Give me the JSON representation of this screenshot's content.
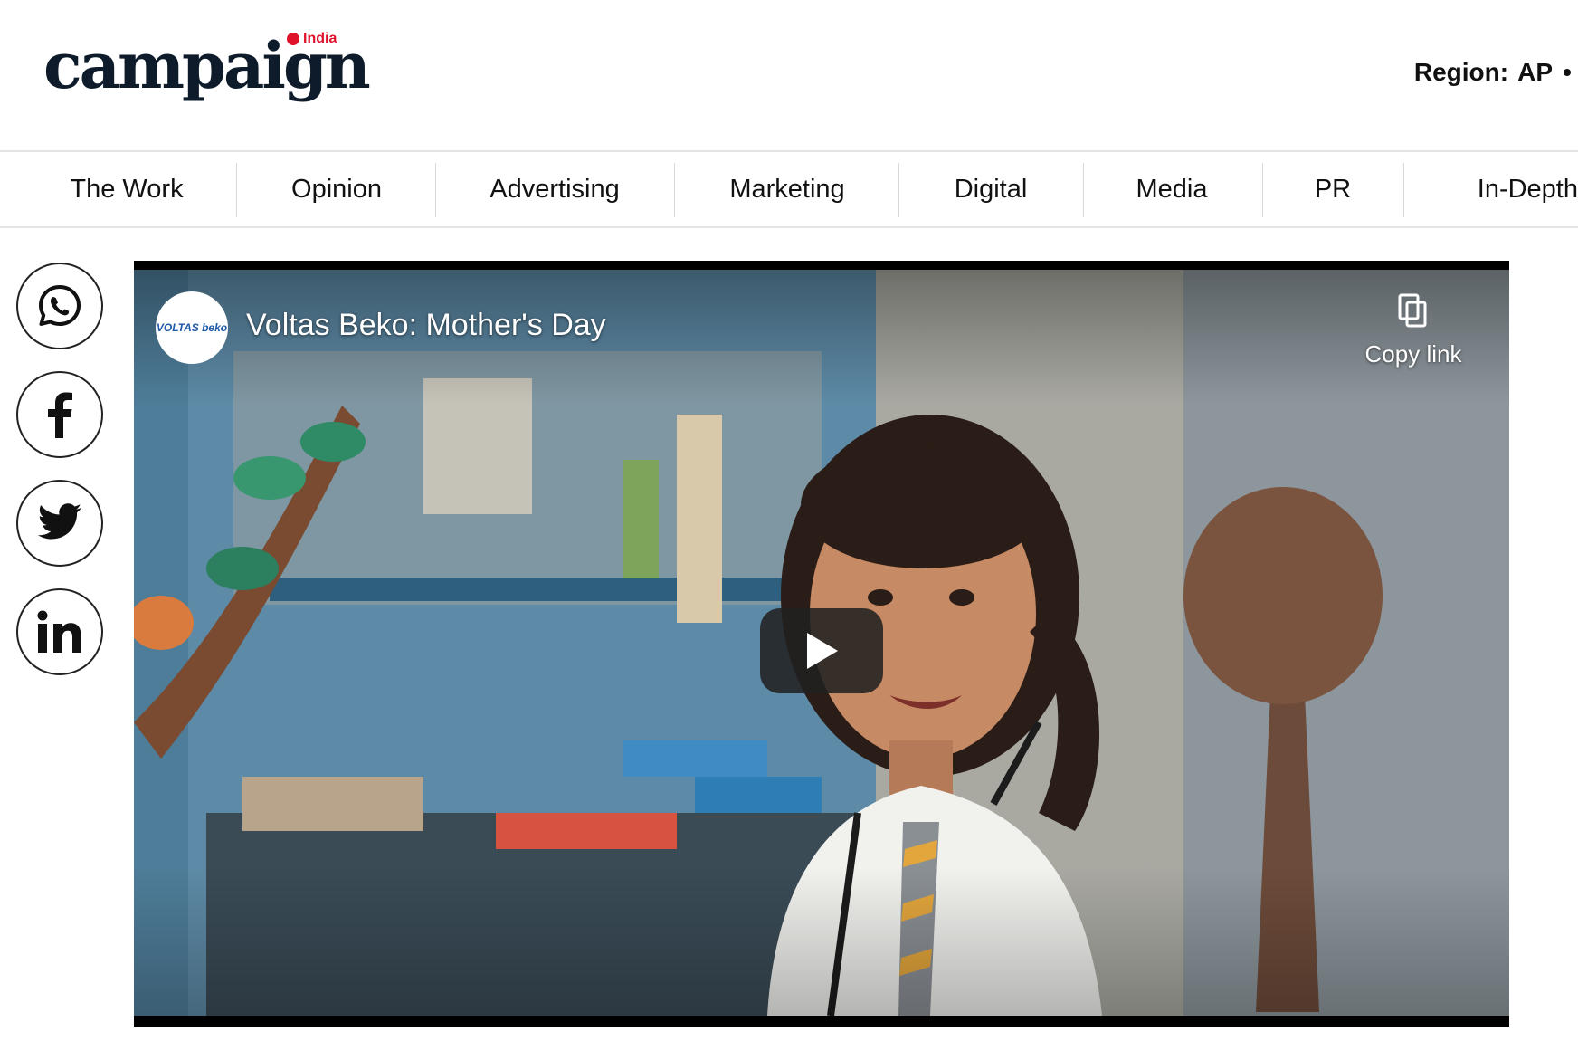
{
  "logo": {
    "wordmark": "campaign",
    "edition": "India"
  },
  "region": {
    "label": "Region:",
    "value": "AP"
  },
  "nav": {
    "items": [
      "The Work",
      "Opinion",
      "Advertising",
      "Marketing",
      "Digital",
      "Media",
      "PR",
      "In-Depth"
    ]
  },
  "share": {
    "icons": [
      "whatsapp-icon",
      "facebook-icon",
      "twitter-icon",
      "linkedin-icon"
    ]
  },
  "video": {
    "channel_logo_text": "VOLTAS beko",
    "title": "Voltas Beko: Mother's Day",
    "copy_link_label": "Copy link",
    "play_icon": "play-icon"
  },
  "colors": {
    "brand_red": "#e0112b",
    "brand_navy": "#0d1b2a",
    "play_bg": "#212121"
  }
}
